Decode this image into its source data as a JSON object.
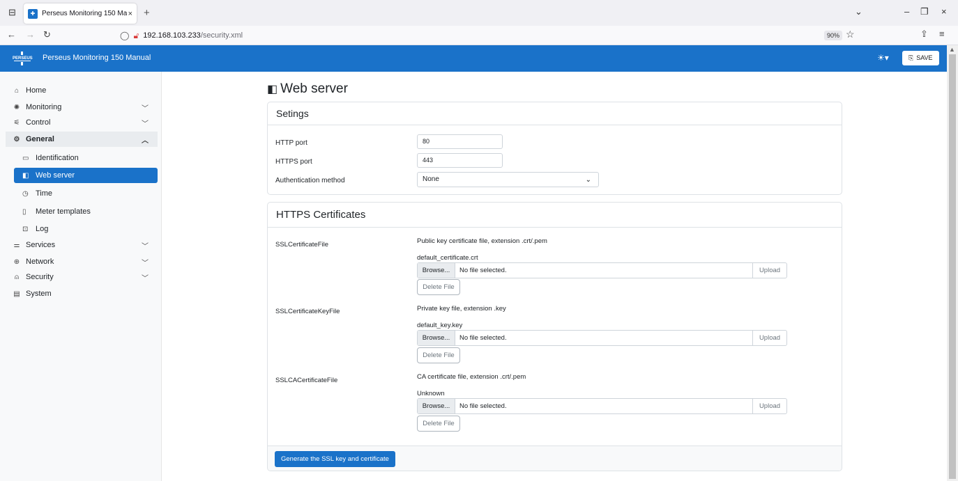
{
  "browser": {
    "tab_title": "Perseus Monitoring 150 Manual",
    "url_host": "192.168.103.233",
    "url_path": "/security.xml",
    "zoom": "90%"
  },
  "header": {
    "logo_text": "PERSEUS",
    "title": "Perseus Monitoring 150 Manual",
    "save_label": "SAVE"
  },
  "sidebar": {
    "items": [
      {
        "label": "Home",
        "icon": "home-icon"
      },
      {
        "label": "Monitoring",
        "icon": "monitoring-icon"
      },
      {
        "label": "Control",
        "icon": "control-icon"
      },
      {
        "label": "General",
        "icon": "gear-icon"
      },
      {
        "label": "Identification",
        "icon": "id-card-icon"
      },
      {
        "label": "Web server",
        "icon": "web-server-icon"
      },
      {
        "label": "Time",
        "icon": "clock-icon"
      },
      {
        "label": "Meter templates",
        "icon": "file-icon"
      },
      {
        "label": "Log",
        "icon": "log-icon"
      },
      {
        "label": "Services",
        "icon": "services-icon"
      },
      {
        "label": "Network",
        "icon": "globe-icon"
      },
      {
        "label": "Security",
        "icon": "lock-icon"
      },
      {
        "label": "System",
        "icon": "system-icon"
      }
    ]
  },
  "page": {
    "title": "Web server",
    "settings": {
      "title": "Setings",
      "http_port_label": "HTTP port",
      "http_port_value": "80",
      "https_port_label": "HTTPS port",
      "https_port_value": "443",
      "auth_label": "Authentication method",
      "auth_value": "None"
    },
    "certs": {
      "title": "HTTPS Certificates",
      "browse_label": "Browse...",
      "no_file_label": "No file selected.",
      "upload_label": "Upload",
      "delete_label": "Delete File",
      "generate_label": "Generate the SSL key and certificate",
      "items": [
        {
          "name": "SSLCertificateFile",
          "desc": "Public key certificate file, extension .crt/.pem",
          "current": "default_certificate.crt"
        },
        {
          "name": "SSLCertificateKeyFile",
          "desc": "Private key file, extension .key",
          "current": "default_key.key"
        },
        {
          "name": "SSLCACertificateFile",
          "desc": "CA certificate file, extension .crt/.pem",
          "current": "Unknown"
        }
      ]
    }
  },
  "colors": {
    "accent": "#1a72c9"
  }
}
